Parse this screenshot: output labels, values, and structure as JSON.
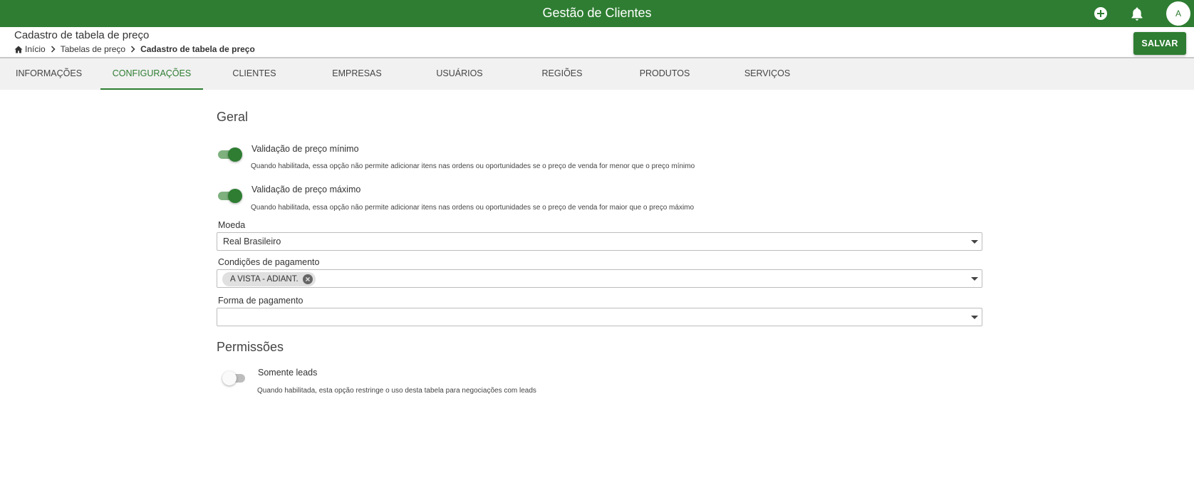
{
  "app": {
    "title": "Gestão de Clientes",
    "avatar_initial": "A",
    "accent_color": "#2e7d32"
  },
  "topbar": {
    "icons": [
      "add-circle-icon",
      "bell-icon"
    ]
  },
  "header": {
    "title": "Cadastro de tabela de preço",
    "breadcrumb": [
      "Início",
      "Tabelas de preço",
      "Cadastro de tabela de preço"
    ],
    "save_label": "SALVAR"
  },
  "tabs": [
    {
      "label": "INFORMAÇÕES",
      "active": false
    },
    {
      "label": "CONFIGURAÇÕES",
      "active": true
    },
    {
      "label": "CLIENTES",
      "active": false
    },
    {
      "label": "EMPRESAS",
      "active": false
    },
    {
      "label": "USUÁRIOS",
      "active": false
    },
    {
      "label": "REGIÕES",
      "active": false
    },
    {
      "label": "PRODUTOS",
      "active": false
    },
    {
      "label": "SERVIÇOS",
      "active": false
    }
  ],
  "geral": {
    "title": "Geral",
    "options": [
      {
        "label": "Validação de preço mínimo",
        "description": "Quando habilitada, essa opção não permite adicionar itens nas ordens ou oportunidades se o preço de venda for menor que o preço mínimo",
        "enabled": true
      },
      {
        "label": "Validação de preço máximo",
        "description": "Quando habilitada, essa opção não permite adicionar itens nas ordens ou oportunidades se o preço de venda for maior que o preço máximo",
        "enabled": true
      }
    ],
    "moeda": {
      "label": "Moeda",
      "value": "Real Brasileiro"
    },
    "condicoes": {
      "label": "Condições de pagamento",
      "chips": [
        "A VISTA - ADIANT."
      ]
    },
    "forma": {
      "label": "Forma de pagamento",
      "value": ""
    }
  },
  "permissoes": {
    "title": "Permissões",
    "options": [
      {
        "label": "Somente leads",
        "description": "Quando habilitada, esta opção restringe o uso desta tabela para negociações com leads",
        "enabled": false
      }
    ]
  }
}
